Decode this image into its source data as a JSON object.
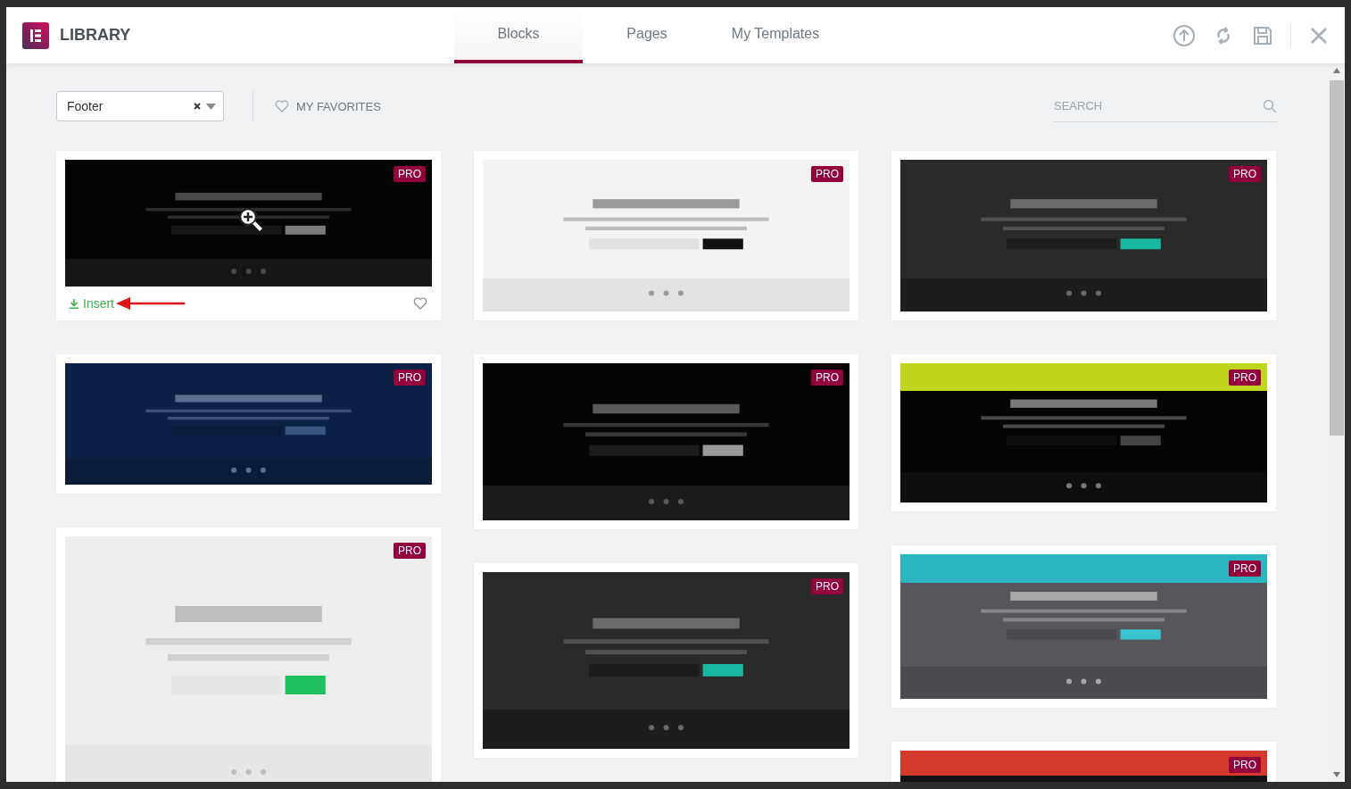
{
  "header": {
    "title": "LIBRARY",
    "tabs": [
      {
        "label": "Blocks",
        "selected": true
      },
      {
        "label": "Pages",
        "selected": false
      },
      {
        "label": "My Templates",
        "selected": false
      }
    ]
  },
  "filter": {
    "value": "Footer"
  },
  "favorites": {
    "label": "MY FAVORITES"
  },
  "search": {
    "placeholder": "SEARCH"
  },
  "columns": [
    {
      "cards": [
        {
          "kind": "black",
          "badge": "PRO",
          "hovered": true,
          "action": "Insert"
        },
        {
          "kind": "navy",
          "badge": "PRO",
          "hovered": false
        },
        {
          "kind": "light",
          "badge": "PRO",
          "hovered": false
        }
      ]
    },
    {
      "cards": [
        {
          "kind": "pale",
          "badge": "PRO",
          "hovered": false
        },
        {
          "kind": "black",
          "badge": "PRO",
          "hovered": false
        },
        {
          "kind": "charcoal",
          "badge": "PRO",
          "hovered": false
        }
      ]
    },
    {
      "cards": [
        {
          "kind": "charcoal",
          "badge": "PRO",
          "hovered": false
        },
        {
          "kind": "lime",
          "badge": "PRO",
          "hovered": false
        },
        {
          "kind": "teal",
          "badge": "PRO",
          "hovered": false
        },
        {
          "kind": "red",
          "badge": "PRO",
          "hovered": false
        }
      ]
    }
  ]
}
